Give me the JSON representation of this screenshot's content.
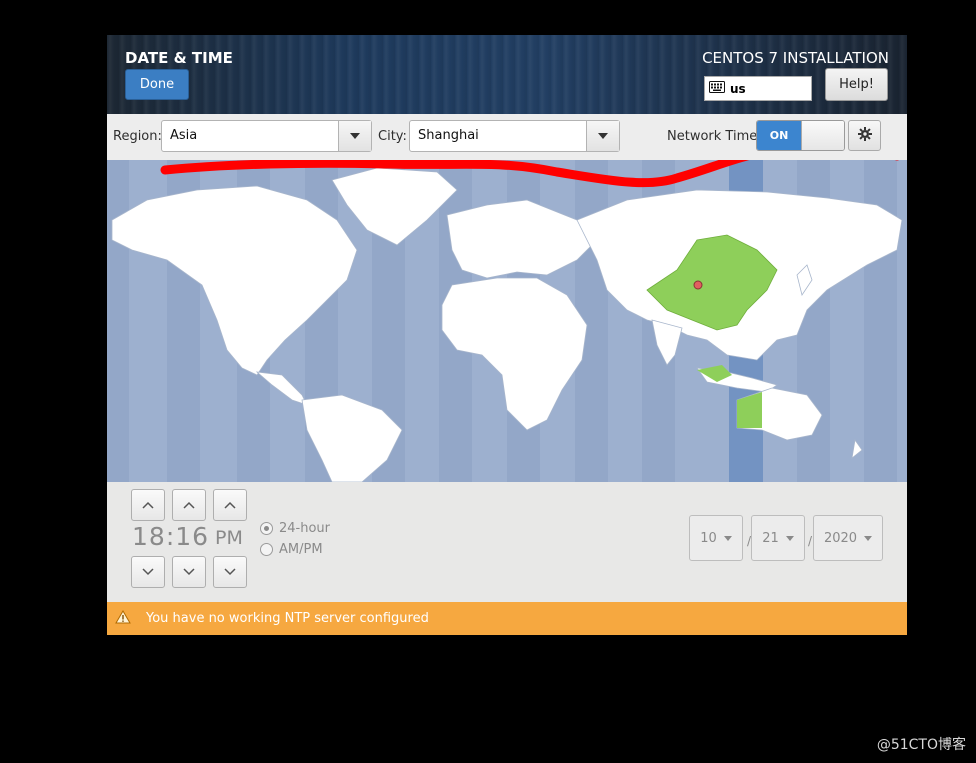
{
  "header": {
    "title": "DATE & TIME",
    "done_label": "Done",
    "product": "CENTOS 7 INSTALLATION",
    "keyboard_layout": "us",
    "help_label": "Help!"
  },
  "toolbar": {
    "region_label": "Region:",
    "region_value": "Asia",
    "city_label": "City:",
    "city_value": "Shanghai",
    "network_time_label": "Network Time",
    "network_time_state": "ON"
  },
  "map": {
    "selected_city": "Shanghai",
    "highlight_color": "#8ecf5a",
    "ocean_color": "#9db0cf",
    "annotation_color": "#ff0000"
  },
  "time": {
    "hours": "18",
    "minutes": "16",
    "separator": ":",
    "period": "PM",
    "format_24h_label": "24-hour",
    "format_ampm_label": "AM/PM",
    "selected_format": "24-hour"
  },
  "date": {
    "month": "10",
    "day": "21",
    "year": "2020",
    "separator": "/"
  },
  "warning": {
    "message": "You have no working NTP server configured",
    "color": "#f6a840"
  },
  "watermark": "@51CTO博客"
}
